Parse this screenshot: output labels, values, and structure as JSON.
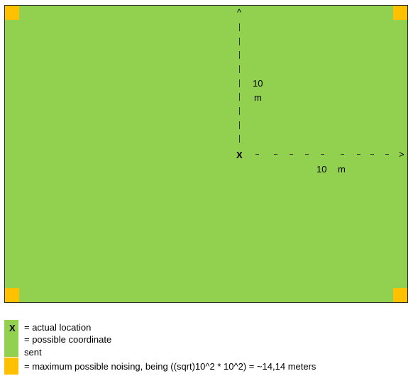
{
  "colors": {
    "field": "#92d050",
    "corner": "#ffc000"
  },
  "diagram": {
    "up_arrow": "^",
    "right_arrow": ">",
    "origin_mark": "X",
    "vertical_label_value": "10",
    "vertical_label_unit": "m",
    "horizontal_label_value": "10",
    "horizontal_label_unit": "m"
  },
  "legend": {
    "x_symbol": "X",
    "actual_location": "= actual location",
    "possible_coordinate_line1": "= possible coordinate",
    "possible_coordinate_line2": "sent",
    "max_noising": "= maximum possible noising, being ((sqrt)10^2 * 10^2) = ~14,14 meters"
  }
}
